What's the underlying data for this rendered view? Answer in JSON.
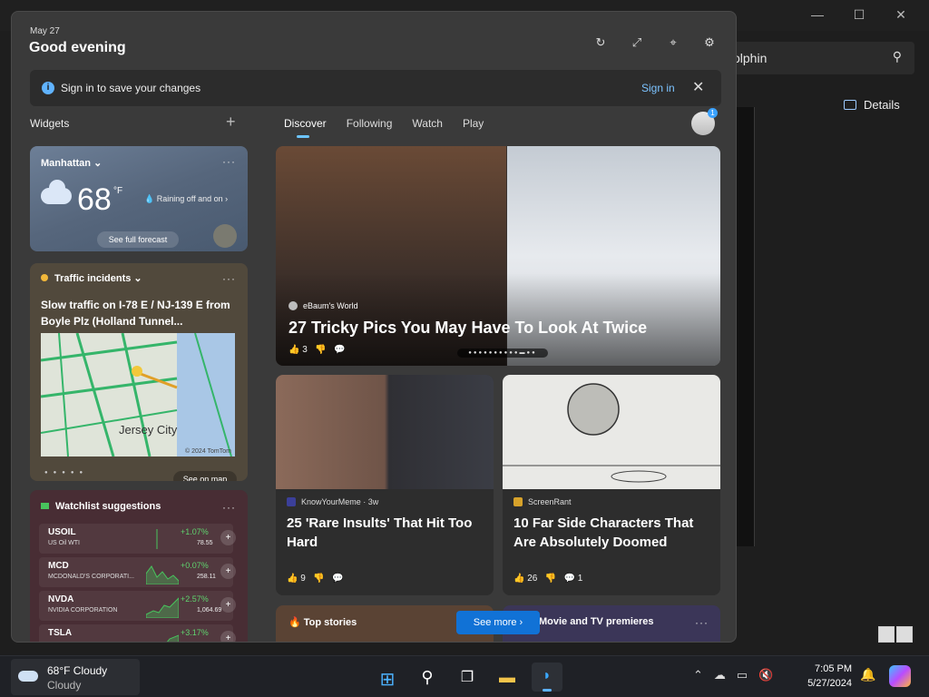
{
  "background_window": {
    "search_value": "olphin",
    "details_label": "Details"
  },
  "widgets_panel": {
    "date": "May 27",
    "greeting": "Good evening",
    "signin_bar": {
      "message": "Sign in to save your changes",
      "link": "Sign in"
    },
    "widgets_label": "Widgets",
    "tabs": [
      "Discover",
      "Following",
      "Watch",
      "Play"
    ],
    "weather": {
      "location": "Manhattan",
      "temp": "68",
      "unit": "°F",
      "condition": "Raining off and on",
      "forecast_button": "See full forecast"
    },
    "traffic": {
      "title": "Traffic incidents",
      "headline": "Slow traffic on I-78 E / NJ-139 E from Boyle Plz (Holland Tunnel...",
      "map_city": "Jersey City",
      "map_copyright": "© 2024 TomTom",
      "see_map": "See on map"
    },
    "watchlist": {
      "title": "Watchlist suggestions",
      "stocks": [
        {
          "symbol": "USOIL",
          "name": "US Oil WTI",
          "change": "+1.07%",
          "price": "78.55"
        },
        {
          "symbol": "MCD",
          "name": "MCDONALD'S CORPORATI...",
          "change": "+0.07%",
          "price": "258.11"
        },
        {
          "symbol": "NVDA",
          "name": "NVIDIA CORPORATION",
          "change": "+2.57%",
          "price": "1,064.69"
        },
        {
          "symbol": "TSLA",
          "name": "",
          "change": "+3.17%",
          "price": ""
        }
      ]
    },
    "hero": {
      "source": "eBaum's World",
      "title": "27 Tricky Pics You May Have To Look At Twice",
      "likes": "3"
    },
    "news": [
      {
        "source": "KnowYourMeme · 3w",
        "title": "25 'Rare Insults' That Hit Too Hard",
        "likes": "9",
        "comments": "",
        "logo_color": "#3b3f99"
      },
      {
        "source": "ScreenRant",
        "title": "10 Far Side Characters That Are Absolutely Doomed",
        "likes": "26",
        "comments": "1",
        "logo_color": "#d7a22a"
      }
    ],
    "bottom_cards": [
      {
        "title": "Top stories"
      },
      {
        "title": "Movie and TV premieres"
      }
    ],
    "see_more": "See more"
  },
  "taskbar": {
    "weather_line1": "68°F Cloudy",
    "weather_line2": "Cloudy",
    "time": "7:05 PM",
    "date": "5/27/2024",
    "apps": [
      "start",
      "search",
      "task-view",
      "file-explorer",
      "dolphin"
    ]
  }
}
